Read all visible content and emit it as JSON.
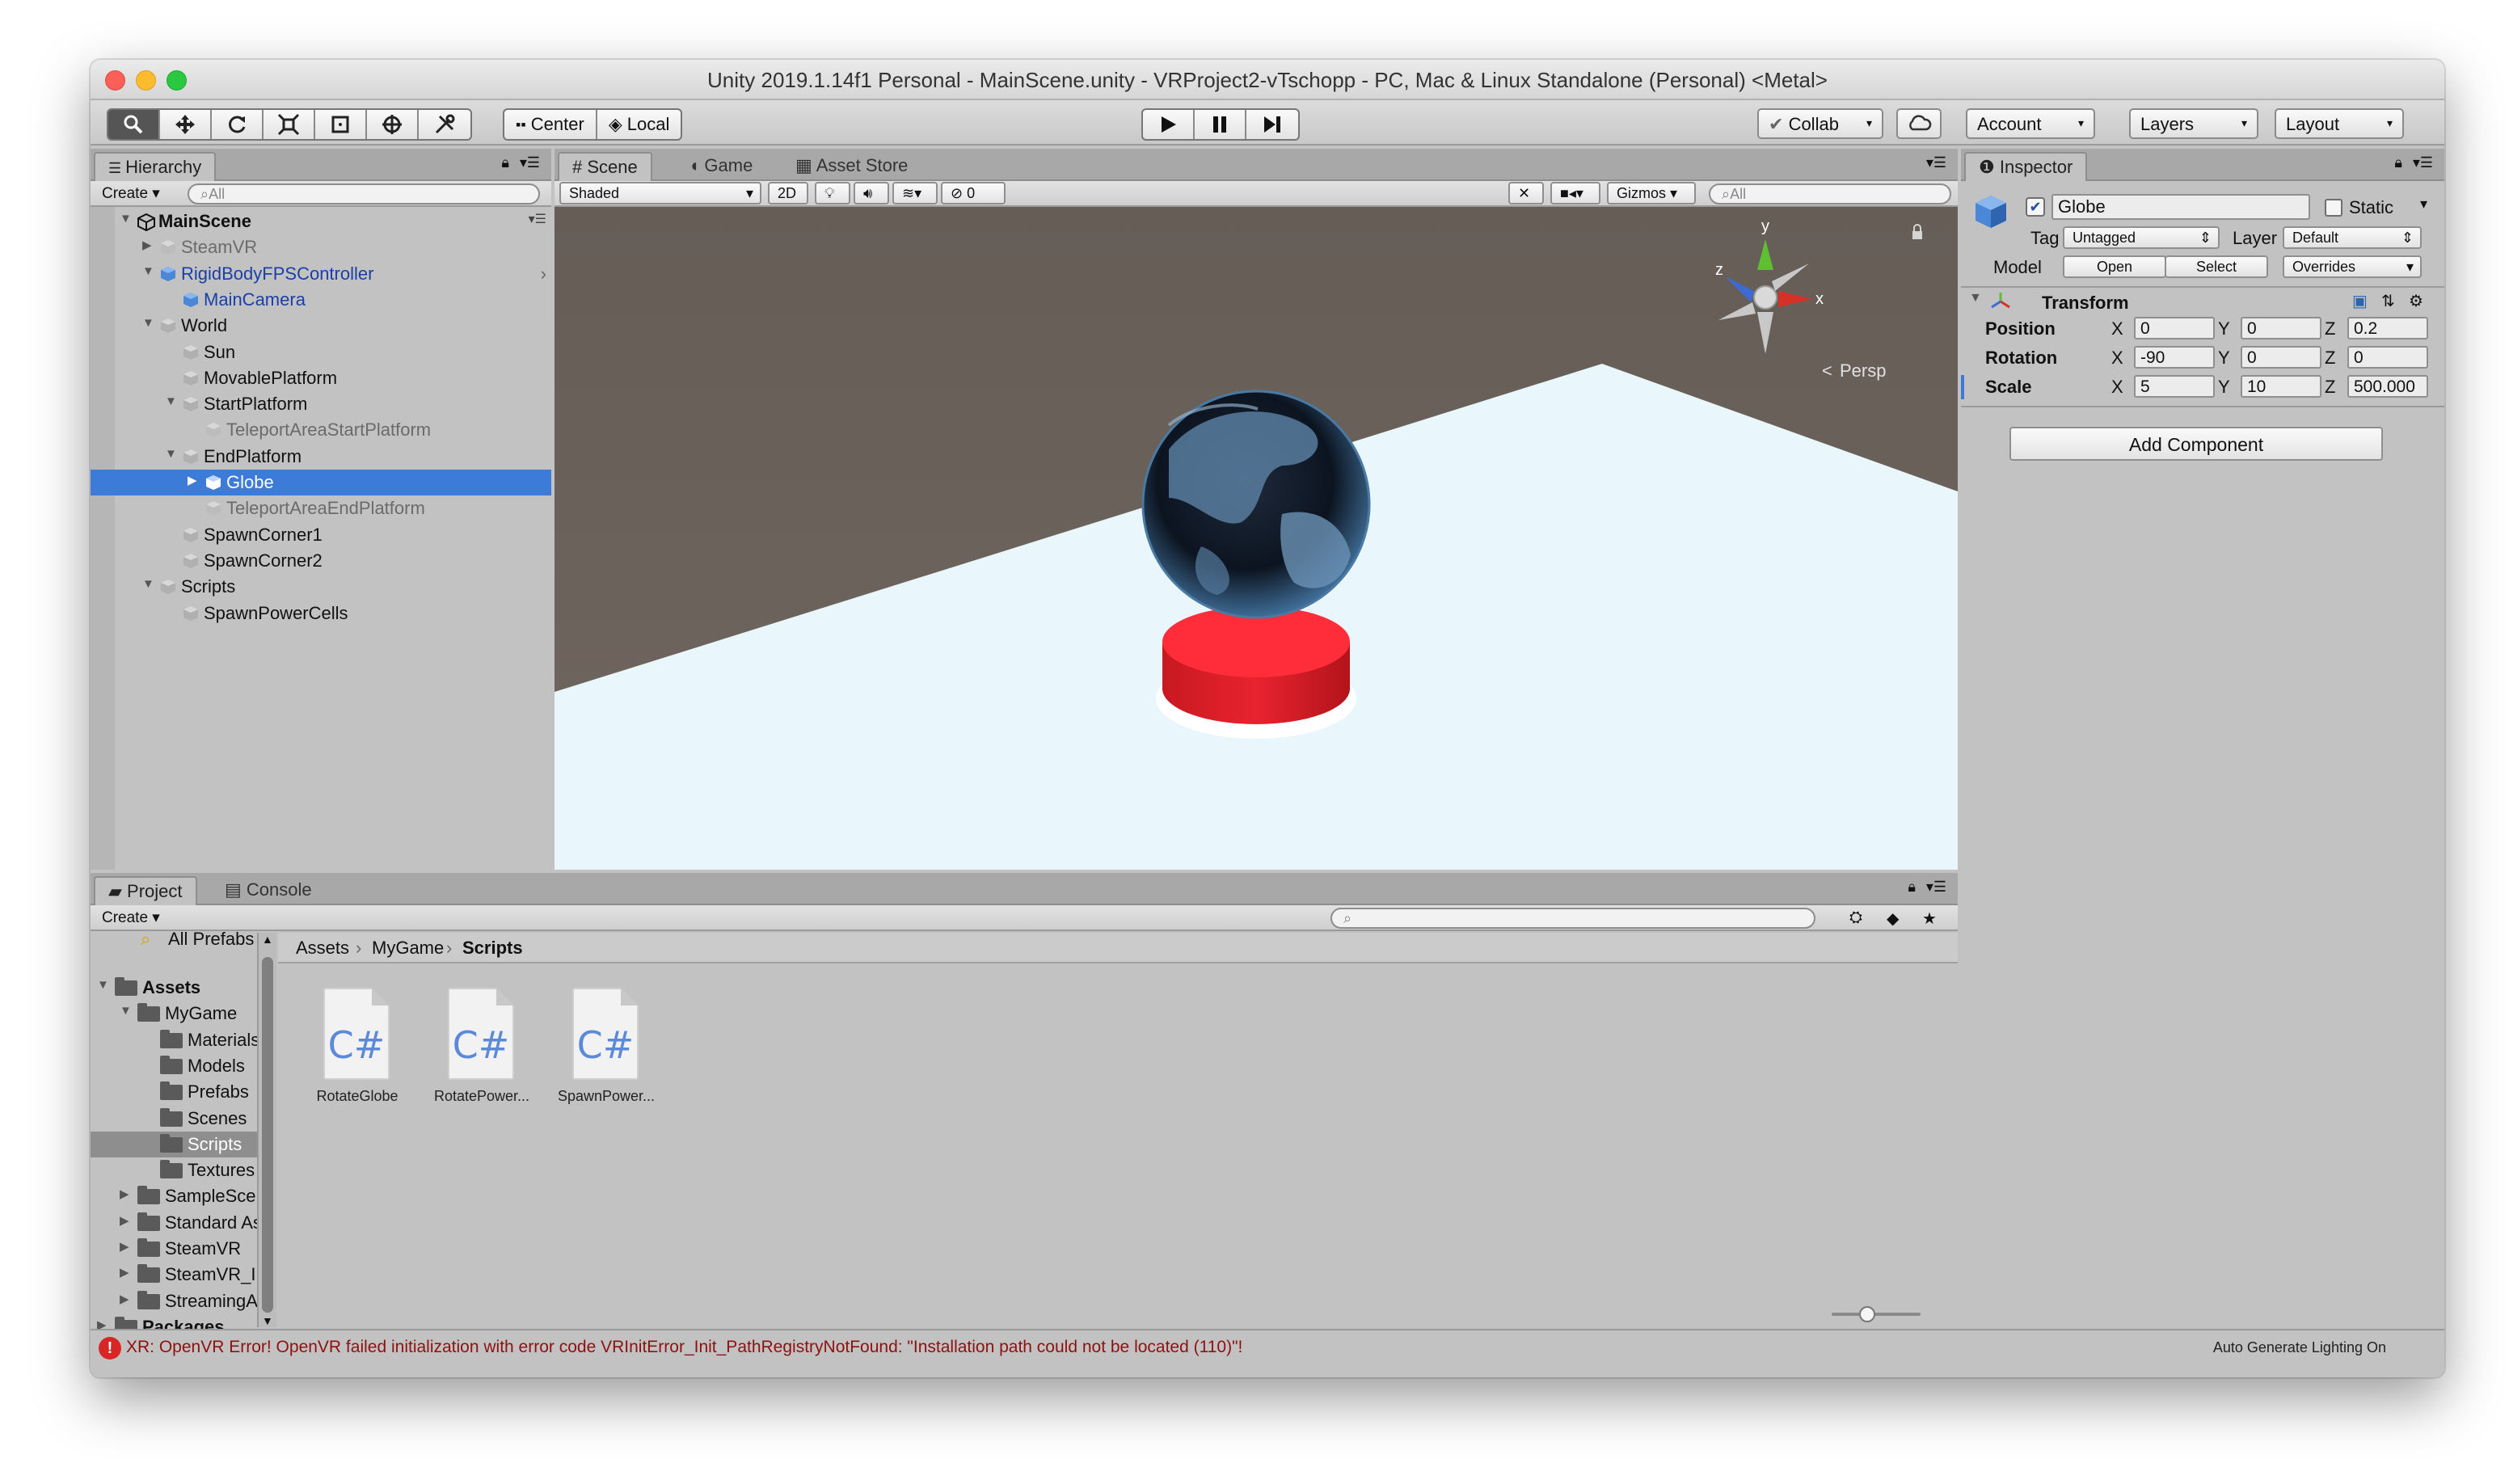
{
  "window": {
    "title": "Unity 2019.1.14f1 Personal - MainScene.unity - VRProject2-vTschopp - PC, Mac & Linux Standalone (Personal) <Metal>"
  },
  "colors": {
    "accent_selection": "#3d7bd8",
    "play_blue": "#2a6cd0",
    "error_red": "#d82626",
    "platform_red": "#e8232f",
    "floor_color": "#e9f6fb"
  },
  "toolbar": {
    "tools": [
      "hand-icon",
      "move-icon",
      "rotate-icon",
      "scale-icon",
      "rect-icon",
      "transform-icon",
      "custom-tool-icon"
    ],
    "pivot_label": "Center",
    "space_label": "Local",
    "collab_label": "Collab",
    "account_label": "Account",
    "layers_label": "Layers",
    "layout_label": "Layout"
  },
  "hierarchy": {
    "tab_label": "Hierarchy",
    "create_label": "Create",
    "search_placeholder": "All",
    "items": [
      {
        "label": "MainScene",
        "color": "#111111",
        "bold": true
      },
      {
        "label": "SteamVR",
        "color": "#6b6b6b"
      },
      {
        "label": "RigidBodyFPSController",
        "color": "#1a3fa8"
      },
      {
        "label": "MainCamera",
        "color": "#1a3fa8"
      },
      {
        "label": "World",
        "color": "#111111"
      },
      {
        "label": "Sun",
        "color": "#111111"
      },
      {
        "label": "MovablePlatform",
        "color": "#111111"
      },
      {
        "label": "StartPlatform",
        "color": "#111111"
      },
      {
        "label": "TeleportAreaStartPlatform",
        "color": "#6b6b6b"
      },
      {
        "label": "EndPlatform",
        "color": "#111111"
      },
      {
        "label": "Globe",
        "color": "#ffffff",
        "selected": true
      },
      {
        "label": "TeleportAreaEndPlatform",
        "color": "#6b6b6b"
      },
      {
        "label": "SpawnCorner1",
        "color": "#111111"
      },
      {
        "label": "SpawnCorner2",
        "color": "#111111"
      },
      {
        "label": "Scripts",
        "color": "#111111"
      },
      {
        "label": "SpawnPowerCells",
        "color": "#111111"
      }
    ]
  },
  "scene": {
    "tabs": [
      "Scene",
      "Game",
      "Asset Store"
    ],
    "shading_mode": "Shaded",
    "mode_2d": "2D",
    "hidden_count": "0",
    "gizmos_label": "Gizmos",
    "search_placeholder": "All",
    "persp_label": "Persp",
    "axis_labels": {
      "x": "x",
      "y": "y",
      "z": "z"
    }
  },
  "project": {
    "tabs": [
      "Project",
      "Console"
    ],
    "create_label": "Create",
    "favorites_item": "All Prefabs",
    "tree": [
      {
        "label": "Assets",
        "bold": true
      },
      {
        "label": "MyGame"
      },
      {
        "label": "Materials"
      },
      {
        "label": "Models"
      },
      {
        "label": "Prefabs"
      },
      {
        "label": "Scenes"
      },
      {
        "label": "Scripts",
        "selected": true
      },
      {
        "label": "Textures"
      },
      {
        "label": "SampleScenes"
      },
      {
        "label": "Standard Assets"
      },
      {
        "label": "SteamVR"
      },
      {
        "label": "SteamVR_Input"
      },
      {
        "label": "StreamingAssets"
      },
      {
        "label": "Packages",
        "bold": true
      }
    ],
    "breadcrumb": [
      "Assets",
      "MyGame",
      "Scripts"
    ],
    "files": [
      {
        "label": "RotateGlobe",
        "icon": "C#"
      },
      {
        "label": "RotatePower...",
        "icon": "C#"
      },
      {
        "label": "SpawnPower...",
        "icon": "C#"
      }
    ],
    "zoom": 0.4
  },
  "inspector": {
    "tab_label": "Inspector",
    "object_name": "Globe",
    "static_label": "Static",
    "tag_label": "Tag",
    "tag_value": "Untagged",
    "layer_label": "Layer",
    "layer_value": "Default",
    "model_label": "Model",
    "open_label": "Open",
    "select_label": "Select",
    "overrides_label": "Overrides",
    "transform_title": "Transform",
    "position": {
      "label": "Position",
      "x": "0",
      "y": "0",
      "z": "0.2"
    },
    "rotation": {
      "label": "Rotation",
      "x": "-90",
      "y": "0",
      "z": "0"
    },
    "scale": {
      "label": "Scale",
      "x": "5",
      "y": "10",
      "z": "500.000"
    },
    "axis": {
      "x": "X",
      "y": "Y",
      "z": "Z"
    },
    "add_component_label": "Add Component"
  },
  "status": {
    "error_message": "XR: OpenVR Error! OpenVR failed initialization with error code VRInitError_Init_PathRegistryNotFound: \"Installation path could not be located (110)\"!",
    "lighting": "Auto Generate Lighting On"
  }
}
